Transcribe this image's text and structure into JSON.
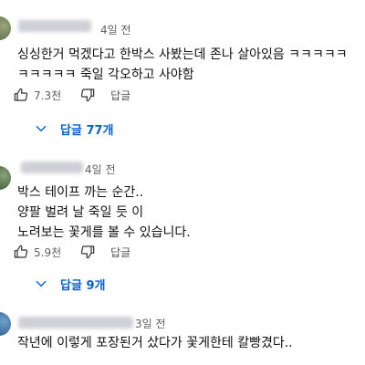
{
  "comments": [
    {
      "time": "4일 전",
      "text_lines": [
        "싱싱한거 먹겠다고 한박스 사봤는데 존나 살아있음 ㅋㅋㅋㅋㅋ",
        "ㅋㅋㅋㅋㅋ 죽일 각오하고 사야함"
      ],
      "likes": "7.3천",
      "reply_label": "답글",
      "replies_toggle": "답글 77개"
    },
    {
      "time": "4일 전",
      "text_lines": [
        "박스 테이프 까는 순간..",
        "양팔 벌려 날 죽일 듯 이",
        "노려보는 꽃게를 볼 수 있습니다."
      ],
      "likes": "5.9천",
      "reply_label": "답글",
      "replies_toggle": "답글 9개"
    },
    {
      "time": "3일 전",
      "text_lines": [
        "작년에 이렇게 포장된거 샀다가 꽃게한테 칼빵겼다.."
      ]
    }
  ],
  "colors": {
    "link": "#065fd4",
    "meta": "#606060",
    "text": "#111111"
  },
  "icons": {
    "like": "thumbs-up-icon",
    "dislike": "thumbs-down-icon",
    "expand": "chevron-down-icon"
  }
}
